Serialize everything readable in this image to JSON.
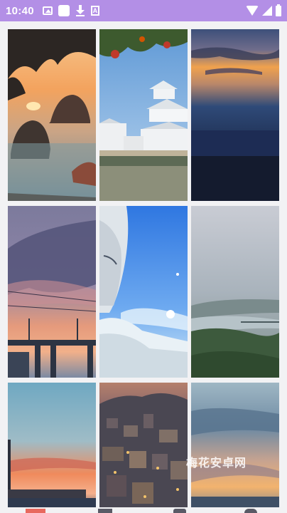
{
  "status_bar": {
    "time": "10:40",
    "left_icons": [
      "image-icon",
      "square-icon",
      "download-icon",
      "a-icon"
    ],
    "right_icons": [
      "wifi-icon",
      "signal-icon",
      "battery-icon"
    ],
    "color": "#b38fe6"
  },
  "gallery": {
    "tiles": [
      {
        "name": "sunset-coast-rocks",
        "colors": [
          "#f3a35e",
          "#6d8590"
        ]
      },
      {
        "name": "japanese-castle",
        "colors": [
          "#7fb2e4",
          "#e8ecef"
        ]
      },
      {
        "name": "dusk-sea-horizon",
        "colors": [
          "#f0a24d",
          "#24385f"
        ]
      },
      {
        "name": "evening-bridge-sky",
        "colors": [
          "#8f86a8",
          "#e59a7c"
        ]
      },
      {
        "name": "anime-character-sky",
        "colors": [
          "#2f77e1",
          "#d7ecf7"
        ]
      },
      {
        "name": "misty-river-valley",
        "colors": [
          "#c9ccd4",
          "#3d5a3d"
        ]
      },
      {
        "name": "sea-sunset-pier",
        "colors": [
          "#6fa8c2",
          "#ef8a5c"
        ]
      },
      {
        "name": "hillside-town-night",
        "colors": [
          "#b5806c",
          "#3a3d49"
        ]
      },
      {
        "name": "cloudy-sunset-sky",
        "colors": [
          "#6e8aa3",
          "#f2b36e"
        ]
      }
    ]
  },
  "watermark": "梅花安卓网",
  "accent": "#e8695e"
}
